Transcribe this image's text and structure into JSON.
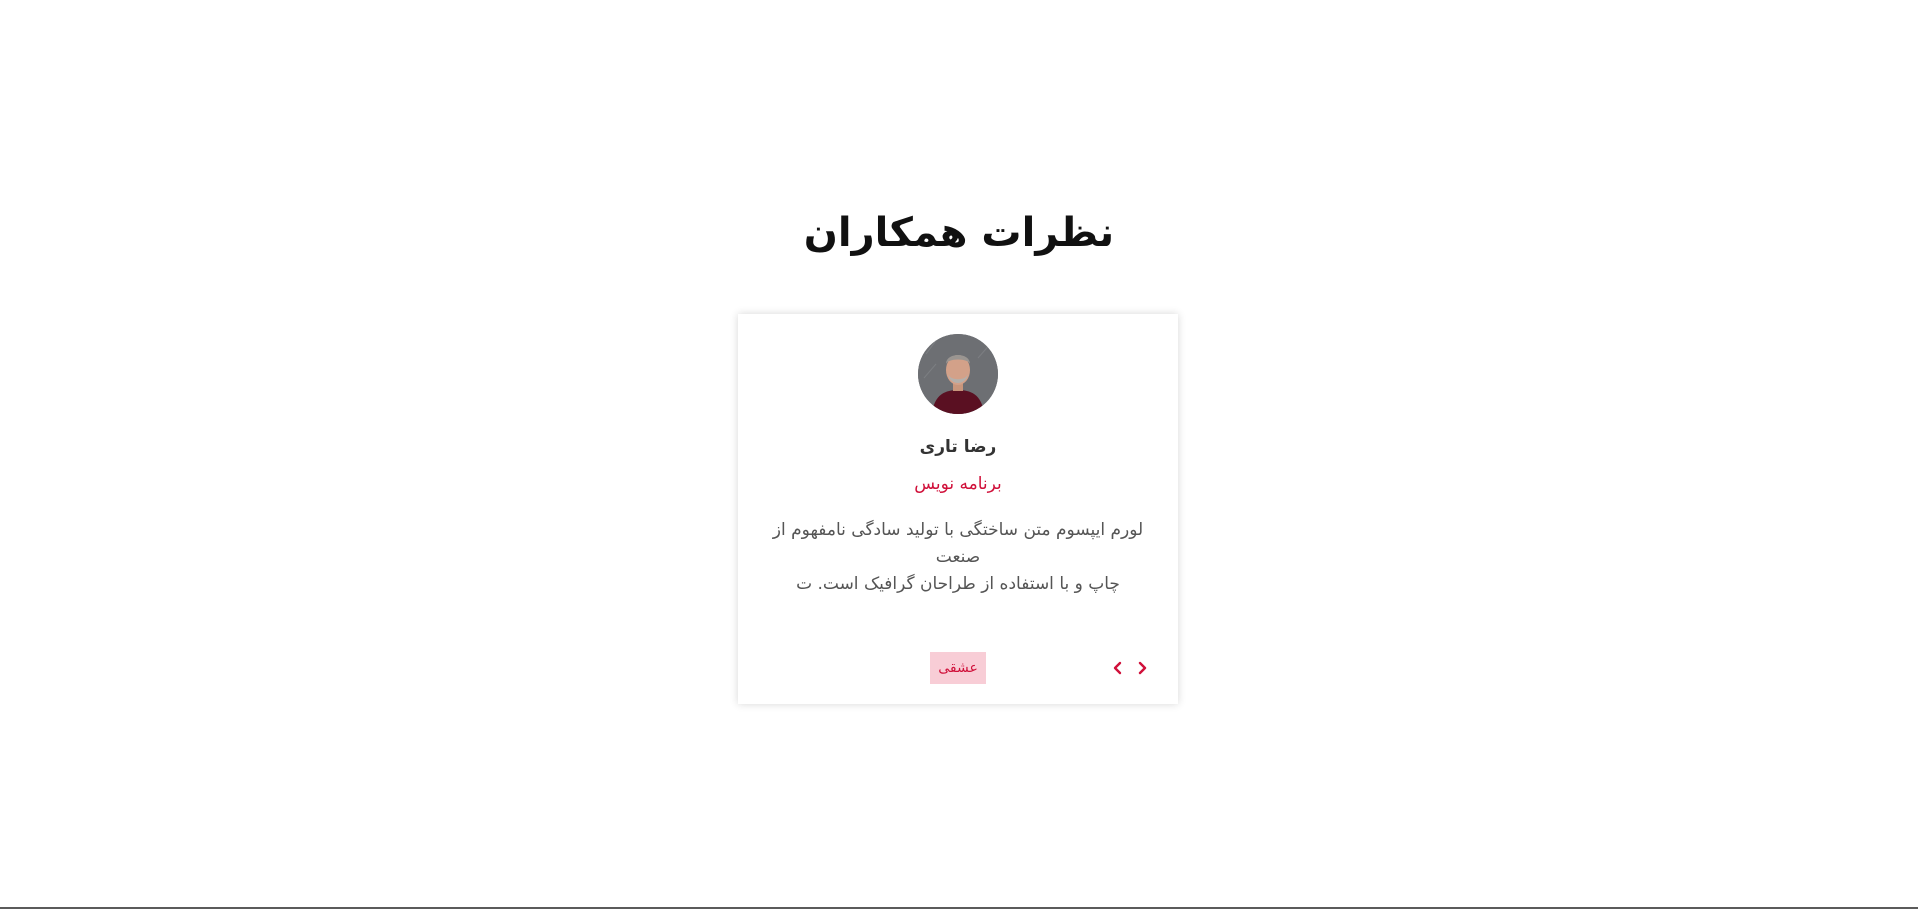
{
  "section": {
    "title": "نظرات همکاران"
  },
  "testimonial": {
    "avatar_icon": "person-avatar",
    "name": "رضا تاری",
    "role": "برنامه نویس",
    "quote_line1": "لورم ایپسوم متن ساختگی با تولید سادگی نامفهوم از صنعت",
    "quote_line2": "چاپ و با استفاده از طراحان گرافیک است. ت",
    "tag": "عشقی"
  },
  "navigation": {
    "prev_icon": "chevron-left-icon",
    "next_icon": "chevron-right-icon"
  },
  "colors": {
    "accent": "#d0103a",
    "tag_background": "#f8cdd6",
    "title": "#111111",
    "body_text": "#555555"
  }
}
